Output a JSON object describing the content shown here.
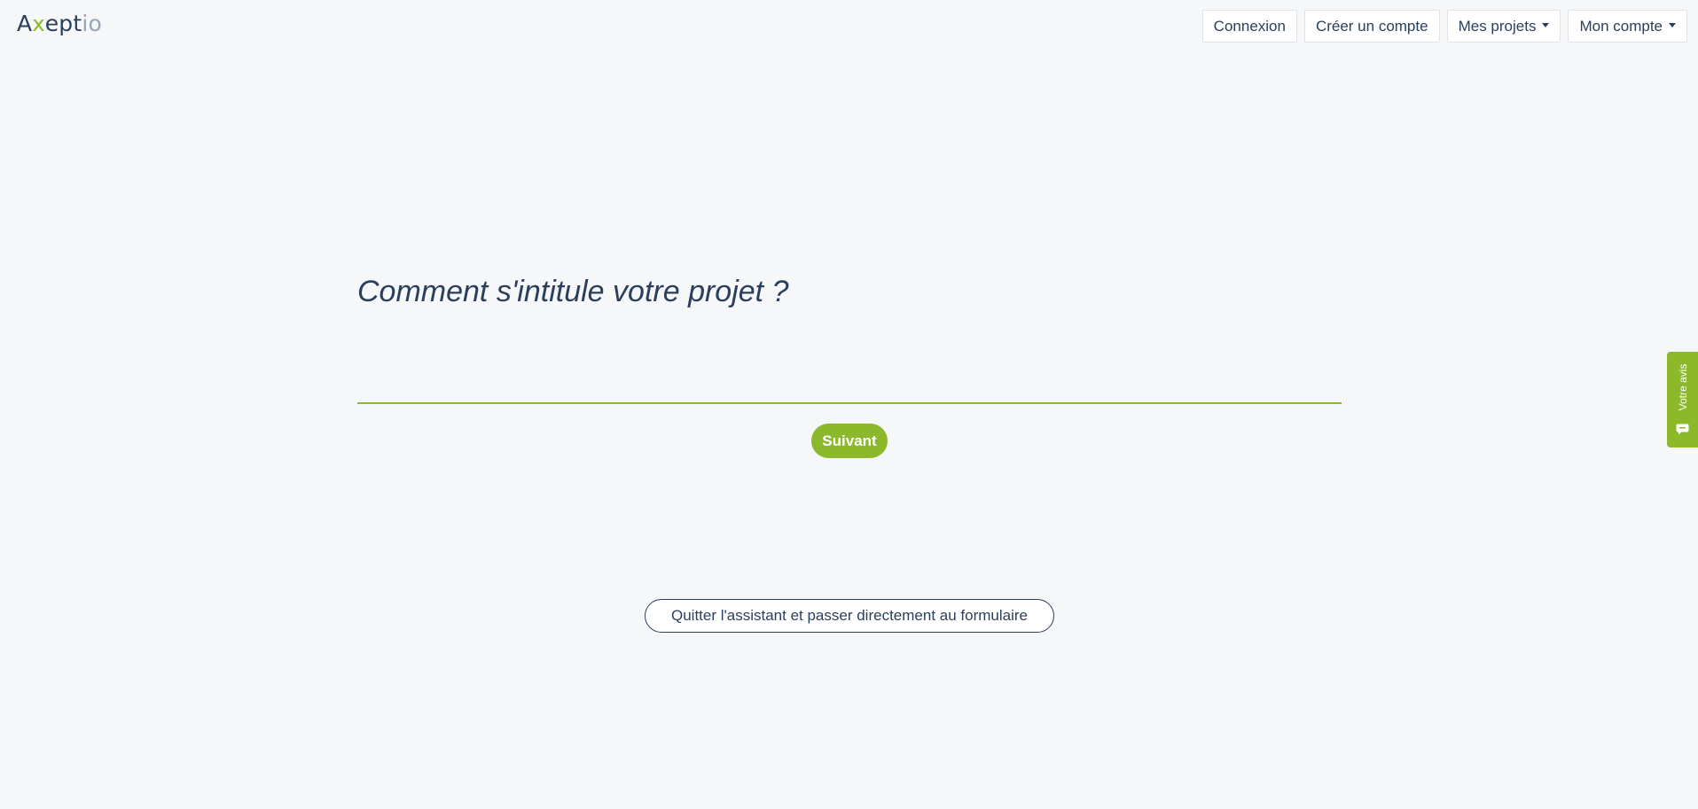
{
  "logo": {
    "part1": "A",
    "part2": "x",
    "part3": "ept",
    "part4": "io"
  },
  "nav": {
    "login": "Connexion",
    "create_account": "Créer un compte",
    "my_projects": "Mes projets",
    "my_account": "Mon compte"
  },
  "question": "Comment s'intitule votre projet ?",
  "answer": {
    "value": "",
    "placeholder": ""
  },
  "next_button": "Suivant",
  "quit_button": "Quitter l'assistant et passer directement au formulaire",
  "feedback_tab": "Votre avis",
  "colors": {
    "accent": "#8cb82b",
    "text": "#2b3f5c",
    "background": "#f5f7f9"
  },
  "icons": {
    "feedback": "chat-icon",
    "dropdown": "caret-down-icon"
  }
}
